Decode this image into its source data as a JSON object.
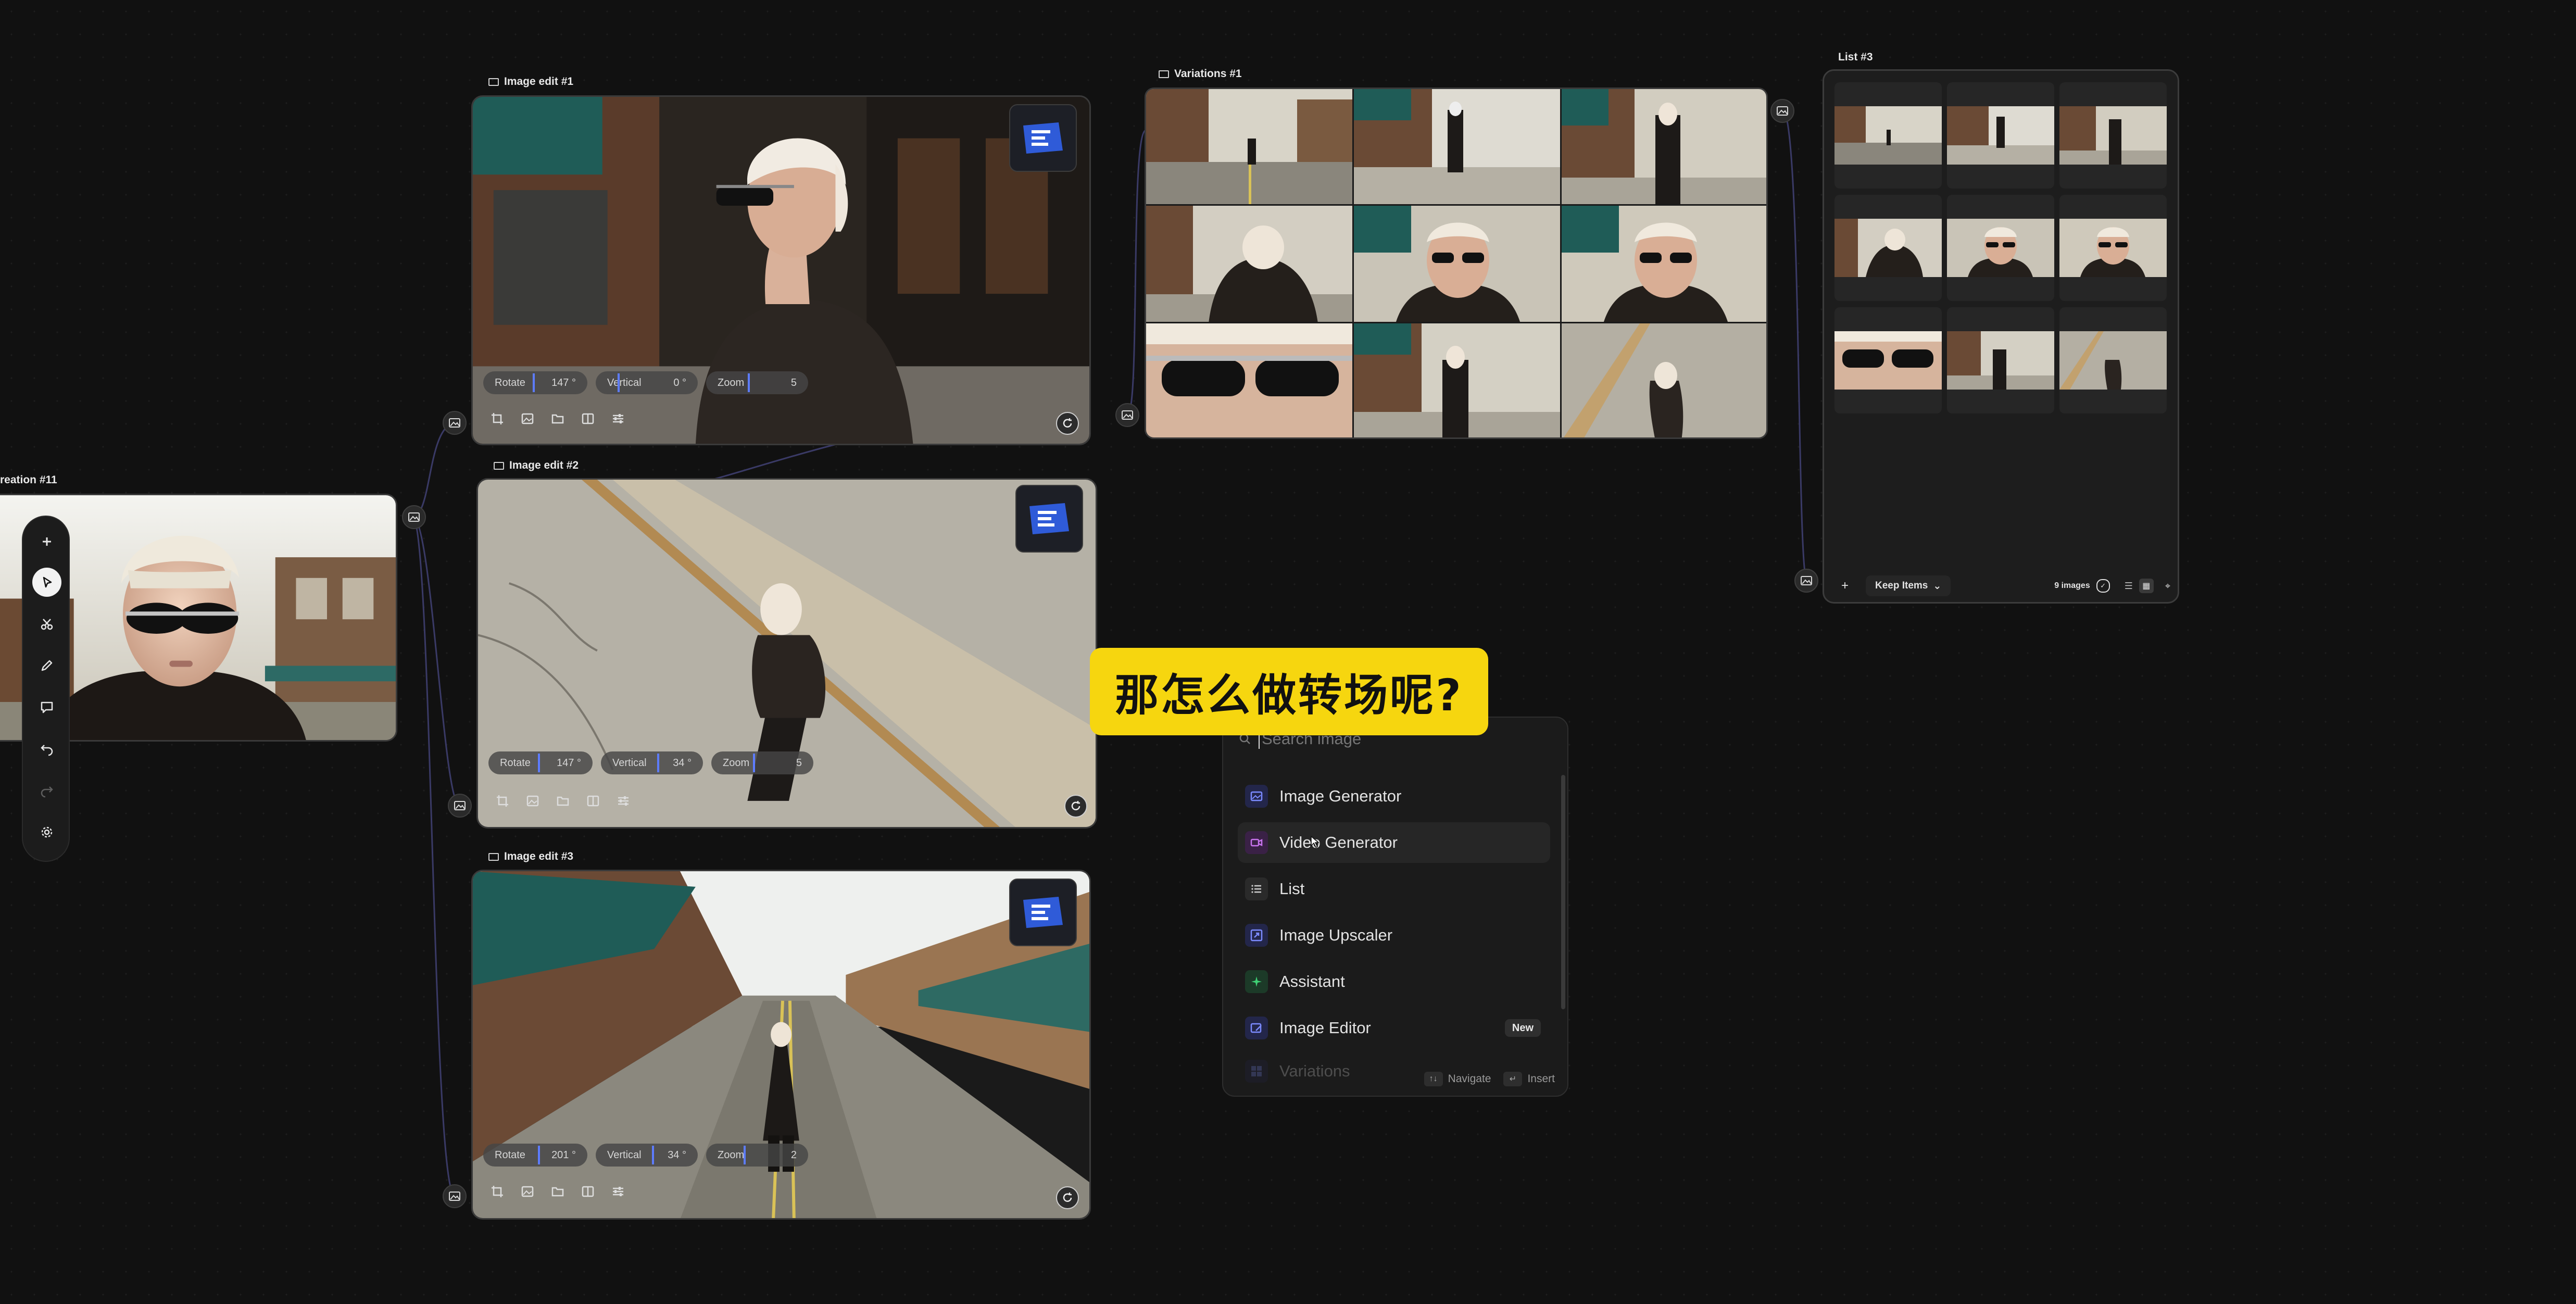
{
  "nodes": {
    "creation": {
      "title": "reation #11"
    },
    "edit1": {
      "title": "Image edit #1",
      "rotate_label": "Rotate",
      "rotate_value": "147 °",
      "vertical_label": "Vertical",
      "vertical_value": "0 °",
      "zoom_label": "Zoom",
      "zoom_value": "5"
    },
    "edit2": {
      "title": "Image edit #2",
      "rotate_label": "Rotate",
      "rotate_value": "147 °",
      "vertical_label": "Vertical",
      "vertical_value": "34 °",
      "zoom_label": "Zoom",
      "zoom_value": "5"
    },
    "edit3": {
      "title": "Image edit #3",
      "rotate_label": "Rotate",
      "rotate_value": "201 °",
      "vertical_label": "Vertical",
      "vertical_value": "34 °",
      "zoom_label": "Zoom",
      "zoom_value": "2"
    },
    "variations": {
      "title": "Variations #1"
    },
    "list": {
      "title": "List #3",
      "add_label": "+",
      "keep_label": "Keep Items",
      "count_label": "9 images"
    }
  },
  "subtitle": "那怎么做转场呢?",
  "menu": {
    "search_placeholder": "Search image",
    "items": [
      {
        "label": "Image Generator",
        "icon": "image-generator-icon",
        "color": "#5b6cff"
      },
      {
        "label": "Video Generator",
        "icon": "video-generator-icon",
        "color": "#c060e0"
      },
      {
        "label": "List",
        "icon": "list-icon",
        "color": "#bbbbbb"
      },
      {
        "label": "Image Upscaler",
        "icon": "image-upscaler-icon",
        "color": "#5b6cff"
      },
      {
        "label": "Assistant",
        "icon": "assistant-icon",
        "color": "#35c46a"
      },
      {
        "label": "Image Editor",
        "icon": "image-editor-icon",
        "color": "#5b6cff",
        "badge": "New"
      },
      {
        "label": "Variations",
        "icon": "variations-icon",
        "color": "#5b6cff"
      }
    ],
    "footer": {
      "navigate_label": "Navigate",
      "insert_label": "Insert"
    }
  },
  "colors": {
    "accent": "#5d7cff",
    "subtitle_bg": "#f6d60f",
    "canvas": "#111111"
  }
}
